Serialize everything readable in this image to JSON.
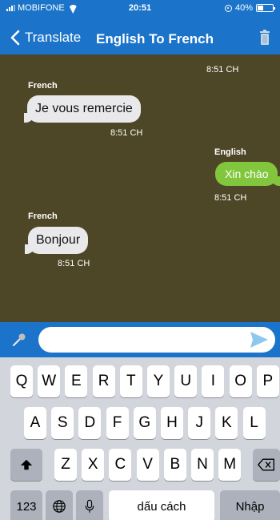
{
  "status_bar": {
    "carrier": "MOBIFONE",
    "time": "20:51",
    "battery": "40%",
    "battery_level": 0.4
  },
  "nav": {
    "back_label": "Translate",
    "title": "English To French",
    "icons": {
      "back": "chevron-left-icon",
      "trash": "trash-icon"
    }
  },
  "chat": {
    "top_timestamp": "8:51 CH",
    "messages": [
      {
        "label": "French",
        "text": "Je vous remercie",
        "time": "8:51 CH",
        "side": "left"
      },
      {
        "label": "English",
        "text": "Xin chào",
        "time": "8:51 CH",
        "side": "right"
      },
      {
        "label": "French",
        "text": "Bonjour",
        "time": "8:51 CH",
        "side": "left"
      }
    ]
  },
  "input": {
    "value": "",
    "placeholder": "",
    "icons": {
      "mic": "microphone-icon",
      "send": "send-icon"
    }
  },
  "keyboard": {
    "row1": [
      "Q",
      "W",
      "E",
      "R",
      "T",
      "Y",
      "U",
      "I",
      "O",
      "P"
    ],
    "row2": [
      "A",
      "S",
      "D",
      "F",
      "G",
      "H",
      "J",
      "K",
      "L"
    ],
    "row3": [
      "Z",
      "X",
      "C",
      "V",
      "B",
      "N",
      "M"
    ],
    "numbers": "123",
    "space": "dấu cách",
    "return": "Nhập"
  },
  "colors": {
    "header": "#1b74c9",
    "chat_bg": "#4e4727",
    "incoming_bubble": "#e9e9eb",
    "outgoing_bubble": "#82c63d",
    "keyboard_bg": "#d2d5db",
    "send_icon": "#8fc8ee"
  }
}
